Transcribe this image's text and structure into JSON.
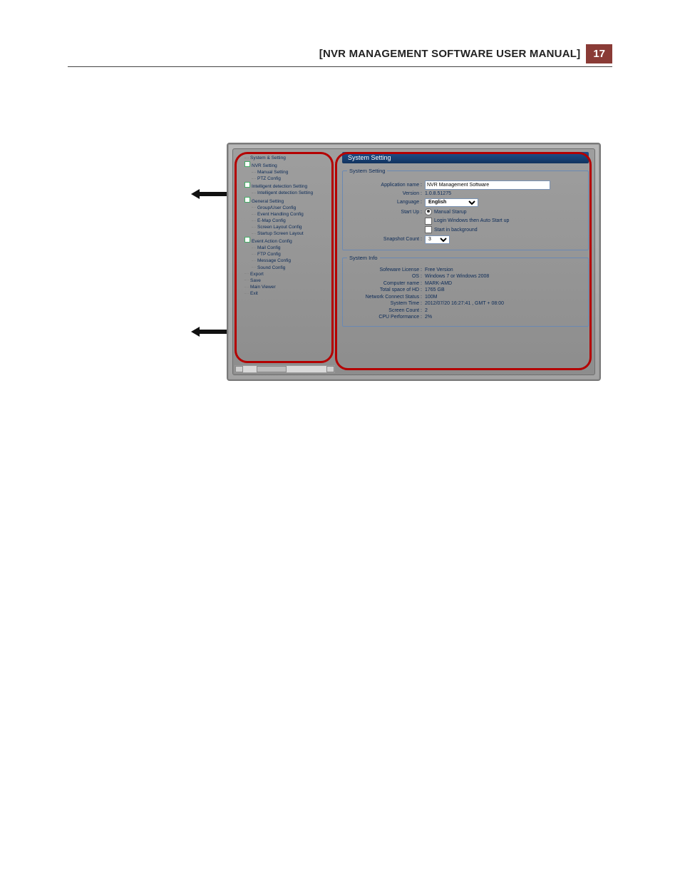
{
  "header": {
    "title": "[NVR MANAGEMENT SOFTWARE USER MANUAL]",
    "page_number": "17"
  },
  "tree": {
    "root": "System & Setting",
    "nvr": {
      "label": "NVR  Setting",
      "manual": "Manual Setting",
      "ptz": "PTZ Config"
    },
    "intel": {
      "label": "Intelligent detection Setting",
      "child": "Intelligent detection Setting"
    },
    "general": {
      "label": "General Setting",
      "group": "Group/User Config",
      "event_handling": "Event Handling Config",
      "emap": "E-Map Config",
      "screen_layout": "Screen Layout Config",
      "startup_screen": "Startup Screen Layout"
    },
    "event_action": {
      "label": "Event Action Config",
      "mail": "Mail Config",
      "ftp": "FTP Config",
      "message": "Message Config",
      "sound": "Sound Config"
    },
    "export": "Export",
    "save": "Save",
    "main_viewer": "Main Viewer",
    "exit": "Exit"
  },
  "panel": {
    "title": "System  Setting",
    "system_setting": {
      "legend": "System Setting",
      "app_name_label": "Application name :",
      "app_name_value": "NVR Management Software",
      "version_label": "Version :",
      "version_value": "1.0.8.51275",
      "language_label": "Language :",
      "language_value": "English",
      "startup_label": "Start Up :",
      "startup_opt_manual": "Manual Starup",
      "startup_opt_login": "Login Windows then Auto Start up",
      "startup_opt_bg": "Start in background",
      "snapshot_label": "Snapshot Count :",
      "snapshot_value": "3"
    },
    "system_info": {
      "legend": "System Info",
      "license_label": "Sofeware License :",
      "license_value": "Free Version",
      "os_label": "OS :",
      "os_value": "Windows 7 or Windows 2008",
      "computer_label": "Computer name :",
      "computer_value": "MARK-AMD",
      "hd_label": "Total space of HD :",
      "hd_value": "1765 GB",
      "net_label": "Network Connect Status :",
      "net_value": "100M",
      "time_label": "System Time :",
      "time_value": "2012/07/20 16:27:41 , GMT + 08:00",
      "screen_label": "Screen Count :",
      "screen_value": "2",
      "cpu_label": "CPU Performance :",
      "cpu_value": "2%"
    }
  }
}
